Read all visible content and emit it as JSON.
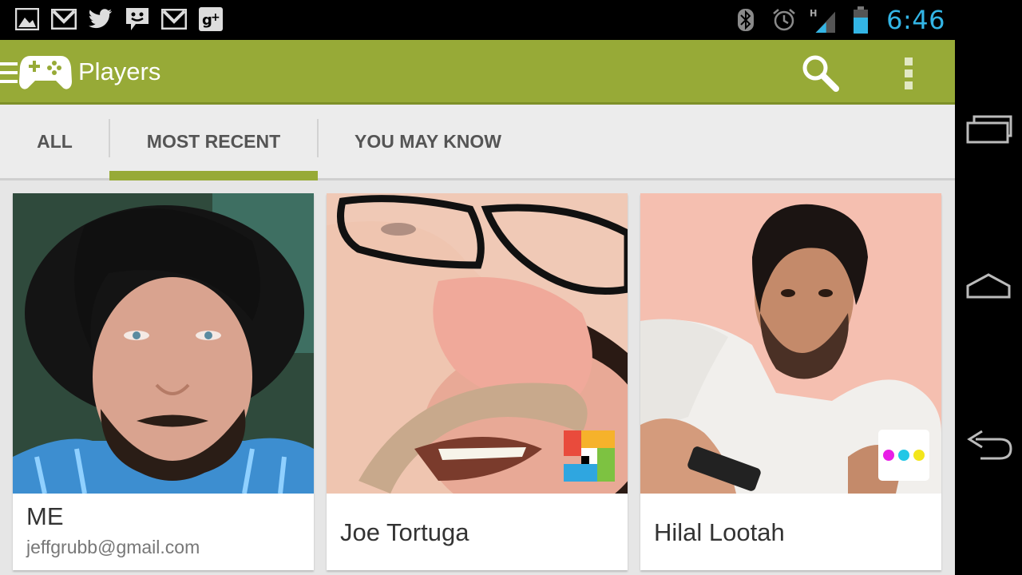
{
  "statusbar": {
    "left_icons": [
      "gallery-icon",
      "gmail-icon",
      "twitter-icon",
      "talk-icon",
      "gmail-icon",
      "google-plus-icon"
    ],
    "right_icons": [
      "bluetooth-icon",
      "alarm-icon",
      "signal-h-icon",
      "battery-icon"
    ],
    "time": "6:46"
  },
  "actionbar": {
    "title": "Players",
    "accent": "#97aa37"
  },
  "tabs": [
    {
      "label": "ALL",
      "selected": false
    },
    {
      "label": "MOST RECENT",
      "selected": true
    },
    {
      "label": "YOU MAY KNOW",
      "selected": false
    }
  ],
  "cards": [
    {
      "name": "ME",
      "email": "jeffgrubb@gmail.com",
      "badge": ""
    },
    {
      "name": "Joe Tortuga",
      "badge": "colorful-squares-game-icon"
    },
    {
      "name": "Hilal Lootah",
      "badge": "three-dots-game-icon"
    }
  ],
  "navbar": [
    "recent-apps-icon",
    "home-icon",
    "back-icon"
  ]
}
